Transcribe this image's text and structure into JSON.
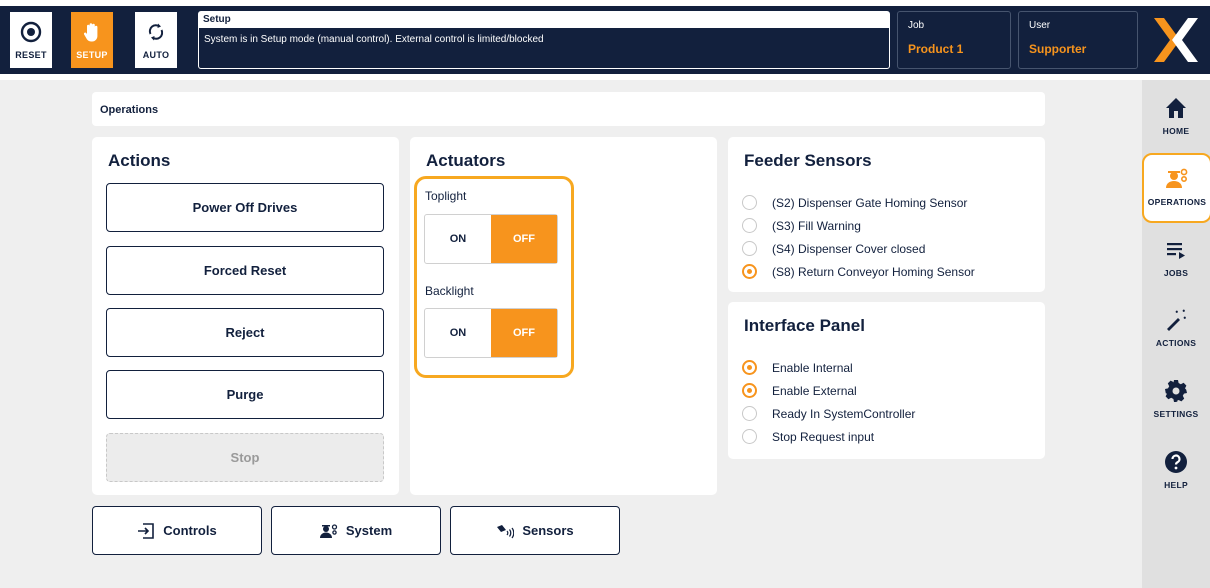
{
  "header": {
    "modes": [
      {
        "label": "RESET",
        "icon": "reset-icon"
      },
      {
        "label": "SETUP",
        "icon": "hand-icon",
        "active": true
      },
      {
        "label": "AUTO",
        "icon": "auto-cycle-icon"
      }
    ],
    "status_title": "Setup",
    "status_message": "System is in Setup mode (manual control). External control is limited/blocked",
    "job_label": "Job",
    "job_value": "Product 1",
    "user_label": "User",
    "user_value": "Supporter"
  },
  "sidebar": {
    "items": [
      {
        "label": "HOME",
        "icon": "home-icon"
      },
      {
        "label": "OPERATIONS",
        "icon": "operations-icon",
        "active": true
      },
      {
        "label": "JOBS",
        "icon": "jobs-icon"
      },
      {
        "label": "ACTIONS",
        "icon": "magic-wand-icon"
      },
      {
        "label": "SETTINGS",
        "icon": "gear-icon"
      },
      {
        "label": "HELP",
        "icon": "help-icon"
      }
    ]
  },
  "breadcrumb": "Operations",
  "actions": {
    "title": "Actions",
    "buttons": [
      "Power Off Drives",
      "Forced Reset",
      "Reject",
      "Purge",
      "Stop"
    ]
  },
  "actuators": {
    "title": "Actuators",
    "toggles": [
      {
        "label": "Toplight",
        "on": "ON",
        "off": "OFF",
        "state": "off"
      },
      {
        "label": "Backlight",
        "on": "ON",
        "off": "OFF",
        "state": "off"
      }
    ]
  },
  "feeder_sensors": {
    "title": "Feeder Sensors",
    "items": [
      {
        "label": "(S2) Dispenser Gate Homing Sensor",
        "active": false
      },
      {
        "label": "(S3) Fill Warning",
        "active": false
      },
      {
        "label": "(S4) Dispenser Cover closed",
        "active": false
      },
      {
        "label": "(S8) Return Conveyor Homing Sensor",
        "active": true
      }
    ]
  },
  "interface_panel": {
    "title": "Interface Panel",
    "items": [
      {
        "label": "Enable Internal",
        "active": true
      },
      {
        "label": "Enable External",
        "active": true
      },
      {
        "label": "Ready In SystemController",
        "active": false
      },
      {
        "label": "Stop Request input",
        "active": false
      }
    ]
  },
  "bottom_buttons": [
    {
      "label": "Controls",
      "icon": "controls-icon"
    },
    {
      "label": "System",
      "icon": "system-icon"
    },
    {
      "label": "Sensors",
      "icon": "sensors-icon"
    }
  ],
  "colors": {
    "navy": "#12203d",
    "accent": "#f7941d",
    "highlight": "#f7a820"
  }
}
